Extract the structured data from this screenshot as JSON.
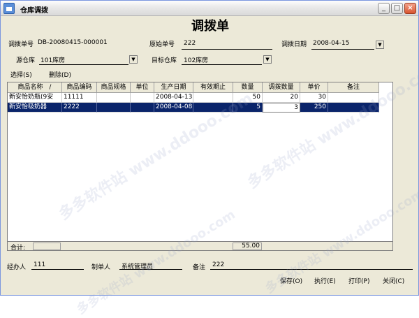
{
  "window": {
    "title": "仓库调拨",
    "min_label": "_",
    "max_label": "□",
    "close_label": "×"
  },
  "doc_title": "调拨单",
  "form": {
    "order_no_label": "调拨单号",
    "order_no_value": "DB-20080415-000001",
    "origin_no_label": "原始单号",
    "origin_no_value": "222",
    "date_label": "调拨日期",
    "date_value": "2008-04-15",
    "src_label": "源仓库",
    "src_value": "101库房",
    "dst_label": "目标仓库",
    "dst_value": "102库房"
  },
  "toolbar": {
    "select_label": "选择(S)",
    "delete_label": "删除(D)"
  },
  "grid": {
    "columns": [
      "商品名称",
      "商品编码",
      "商品规格",
      "单位",
      "生产日期",
      "有效期止",
      "数量",
      "调拨数量",
      "单价",
      "备注"
    ],
    "sort_indicator": "/",
    "rows": [
      [
        "新安怡奶瓶(9安",
        "11111",
        "",
        "",
        "2008-04-13",
        "",
        "50",
        "20",
        "30",
        ""
      ],
      [
        "新安怡吸奶器",
        "2222",
        "",
        "",
        "2008-04-08",
        "",
        "5",
        "3",
        "250",
        ""
      ]
    ],
    "total_label": "合计:",
    "total_value": "55.00"
  },
  "footer": {
    "handler_label": "经办人",
    "handler_value": "111",
    "maker_label": "制单人",
    "maker_value": "系统管理员",
    "note_label": "备注",
    "note_value": "222"
  },
  "buttons": {
    "save": "保存(O)",
    "execute": "执行(E)",
    "print": "打印(P)",
    "close": "关闭(C)"
  },
  "watermark": "多多软件站 www.ddooo.com",
  "colors": {
    "selection": "#0a246a",
    "window_bg": "#ece9d8"
  }
}
